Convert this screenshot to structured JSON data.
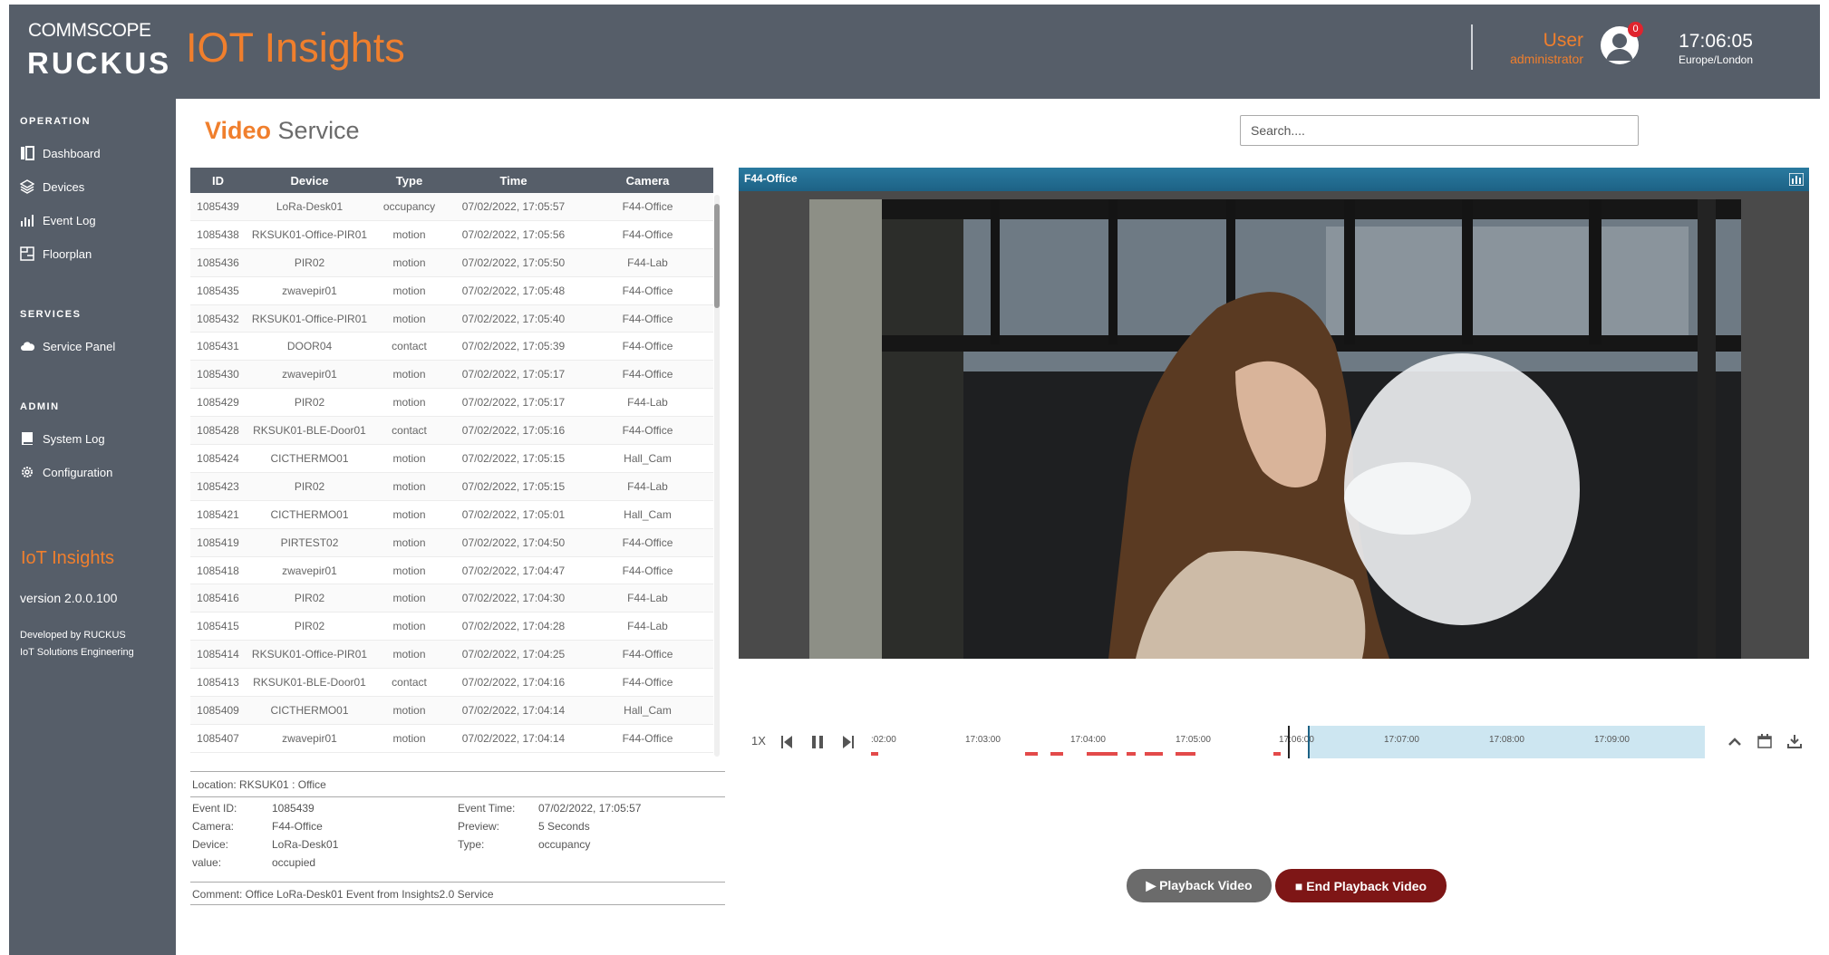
{
  "header": {
    "brand_top": "COMMSCOPE",
    "brand_bottom": "RUCKUS",
    "app_title": "IOT Insights",
    "user_name": "User",
    "user_role": "administrator",
    "notification_count": "0",
    "time": "17:06:05",
    "timezone": "Europe/London"
  },
  "sidebar": {
    "sections": [
      {
        "title": "OPERATION",
        "items": [
          "Dashboard",
          "Devices",
          "Event Log",
          "Floorplan"
        ]
      },
      {
        "title": "SERVICES",
        "items": [
          "Service Panel"
        ]
      },
      {
        "title": "ADMIN",
        "items": [
          "System Log",
          "Configuration"
        ]
      }
    ],
    "app_name": "IoT Insights",
    "version": "version 2.0.0.100",
    "developed_by_1": "Developed by RUCKUS",
    "developed_by_2": "IoT Solutions Engineering"
  },
  "page": {
    "title_highlight": "Video",
    "title_rest": "Service",
    "search_placeholder": "Search...."
  },
  "table": {
    "columns": [
      "ID",
      "Device",
      "Type",
      "Time",
      "Camera"
    ],
    "rows": [
      [
        "1085439",
        "LoRa-Desk01",
        "occupancy",
        "07/02/2022, 17:05:57",
        "F44-Office"
      ],
      [
        "1085438",
        "RKSUK01-Office-PIR01",
        "motion",
        "07/02/2022, 17:05:56",
        "F44-Office"
      ],
      [
        "1085436",
        "PIR02",
        "motion",
        "07/02/2022, 17:05:50",
        "F44-Lab"
      ],
      [
        "1085435",
        "zwavepir01",
        "motion",
        "07/02/2022, 17:05:48",
        "F44-Office"
      ],
      [
        "1085432",
        "RKSUK01-Office-PIR01",
        "motion",
        "07/02/2022, 17:05:40",
        "F44-Office"
      ],
      [
        "1085431",
        "DOOR04",
        "contact",
        "07/02/2022, 17:05:39",
        "F44-Office"
      ],
      [
        "1085430",
        "zwavepir01",
        "motion",
        "07/02/2022, 17:05:17",
        "F44-Office"
      ],
      [
        "1085429",
        "PIR02",
        "motion",
        "07/02/2022, 17:05:17",
        "F44-Lab"
      ],
      [
        "1085428",
        "RKSUK01-BLE-Door01",
        "contact",
        "07/02/2022, 17:05:16",
        "F44-Office"
      ],
      [
        "1085424",
        "CICTHERMO01",
        "motion",
        "07/02/2022, 17:05:15",
        "Hall_Cam"
      ],
      [
        "1085423",
        "PIR02",
        "motion",
        "07/02/2022, 17:05:15",
        "F44-Lab"
      ],
      [
        "1085421",
        "CICTHERMO01",
        "motion",
        "07/02/2022, 17:05:01",
        "Hall_Cam"
      ],
      [
        "1085419",
        "PIRTEST02",
        "motion",
        "07/02/2022, 17:04:50",
        "F44-Office"
      ],
      [
        "1085418",
        "zwavepir01",
        "motion",
        "07/02/2022, 17:04:47",
        "F44-Office"
      ],
      [
        "1085416",
        "PIR02",
        "motion",
        "07/02/2022, 17:04:30",
        "F44-Lab"
      ],
      [
        "1085415",
        "PIR02",
        "motion",
        "07/02/2022, 17:04:28",
        "F44-Lab"
      ],
      [
        "1085414",
        "RKSUK01-Office-PIR01",
        "motion",
        "07/02/2022, 17:04:25",
        "F44-Office"
      ],
      [
        "1085413",
        "RKSUK01-BLE-Door01",
        "contact",
        "07/02/2022, 17:04:16",
        "F44-Office"
      ],
      [
        "1085409",
        "CICTHERMO01",
        "motion",
        "07/02/2022, 17:04:14",
        "Hall_Cam"
      ],
      [
        "1085407",
        "zwavepir01",
        "motion",
        "07/02/2022, 17:04:14",
        "F44-Office"
      ]
    ]
  },
  "details": {
    "location": "Location: RKSUK01 : Office",
    "event_id_label": "Event ID:",
    "event_id": "1085439",
    "camera_label": "Camera:",
    "camera": "F44-Office",
    "device_label": "Device:",
    "device": "LoRa-Desk01",
    "value_label": "value:",
    "value": "occupied",
    "event_time_label": "Event Time:",
    "event_time": "07/02/2022, 17:05:57",
    "preview_label": "Preview:",
    "preview": "5 Seconds",
    "type_label": "Type:",
    "type": "occupancy",
    "comment": "Comment: Office LoRa-Desk01 Event from Insights2.0 Service"
  },
  "video": {
    "camera_name": "F44-Office",
    "speed": "1X",
    "timeline_labels": [
      ":02:00",
      "17:03:00",
      "17:04:00",
      "17:05:00",
      "17:06:00",
      "17:07:00",
      "17:08:00",
      "17:09:00"
    ]
  },
  "buttons": {
    "playback": "▶ Playback Video",
    "end_playback": "■ End Playback Video"
  },
  "colors": {
    "accent": "#f07f2d",
    "chrome": "#565e69",
    "video_bar": "#1d6285",
    "end_button": "#7e1616",
    "event_marker": "#e34a4a"
  }
}
